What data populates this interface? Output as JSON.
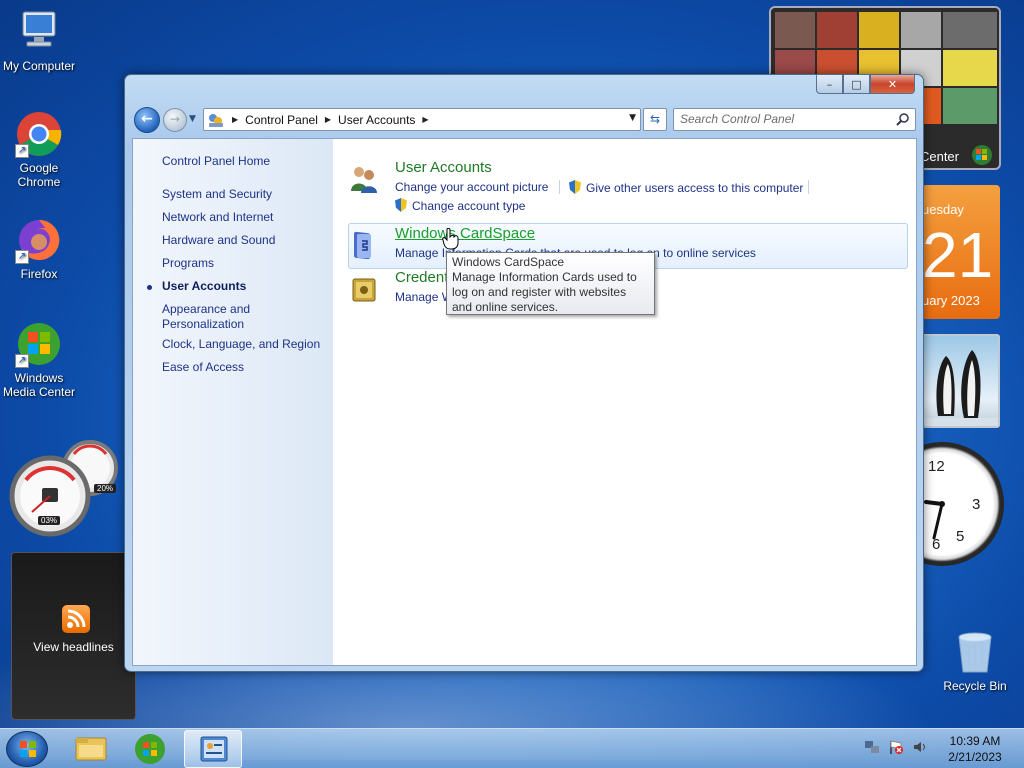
{
  "desktop": {
    "icons": [
      {
        "label": "My Computer"
      },
      {
        "label": "Google Chrome"
      },
      {
        "label": "Firefox"
      },
      {
        "label": "Windows Media Center"
      },
      {
        "label": "Recycle Bin"
      }
    ]
  },
  "gadgets": {
    "media_center_label": "Center",
    "calendar": {
      "day": "uesday",
      "date": "21",
      "month": "uary 2023"
    },
    "cpu": {
      "cpu_percent": "03%",
      "mem_percent": "20%"
    },
    "clock_numbers": [
      "12",
      "3",
      "5",
      "6"
    ],
    "rss": {
      "label": "View headlines"
    }
  },
  "window": {
    "controls": {
      "minimize": "–",
      "maximize": "□",
      "close": "✕"
    },
    "breadcrumbs": [
      "Control Panel",
      "User Accounts"
    ],
    "search": {
      "placeholder": "Search Control Panel"
    },
    "left_nav": [
      "Control Panel Home",
      "System and Security",
      "Network and Internet",
      "Hardware and Sound",
      "Programs",
      "User Accounts",
      "Appearance and Personalization",
      "Clock, Language, and Region",
      "Ease of Access"
    ],
    "categories": {
      "user_accounts": {
        "title": "User Accounts",
        "links": [
          "Change your account picture",
          "Give other users access to this computer",
          "Change account type"
        ]
      },
      "cardspace": {
        "title": "Windows CardSpace",
        "links": [
          "Manage Information Cards that are used to log on to online services"
        ]
      },
      "credential": {
        "title": "Credential Manager",
        "links": [
          "Manage Windows Credentials"
        ]
      }
    },
    "tooltip": {
      "title": "Windows CardSpace",
      "body": "Manage Information Cards used to log on and register with websites and online services."
    }
  },
  "taskbar": {
    "time": "10:39 AM",
    "date": "2/21/2023"
  }
}
